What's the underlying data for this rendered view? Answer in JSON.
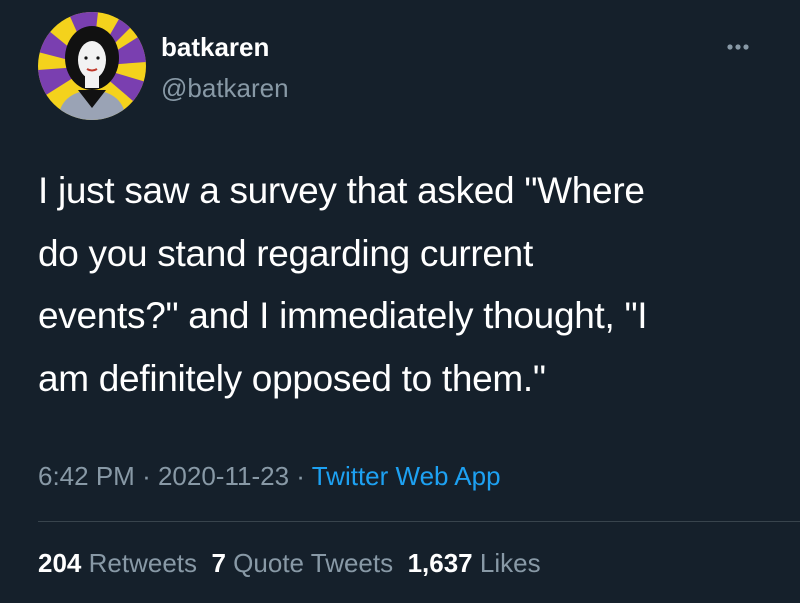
{
  "user": {
    "display_name": "batkaren",
    "handle": "@batkaren",
    "avatar_icon": "profile-illustration-avatar"
  },
  "more_icon": "more-options-icon",
  "tweet": {
    "text": "I just saw a survey that asked \"Where\ndo you stand regarding current\nevents?\" and I immediately thought, \"I\nam definitely opposed to them.\""
  },
  "meta": {
    "time": "6:42 PM",
    "separator": "·",
    "date": "2020-11-23",
    "source": "Twitter Web App"
  },
  "stats": {
    "retweets_count": "204",
    "retweets_label": "Retweets",
    "quotes_count": "7",
    "quotes_label": "Quote Tweets",
    "likes_count": "1,637",
    "likes_label": "Likes"
  },
  "colors": {
    "background": "#15202b",
    "text": "#ffffff",
    "secondary_text": "#8899a6",
    "link": "#1da1f2",
    "divider": "#38444d"
  }
}
